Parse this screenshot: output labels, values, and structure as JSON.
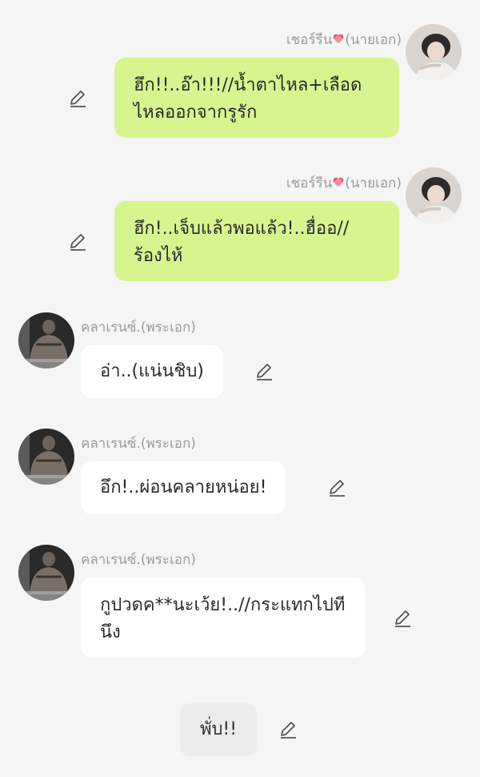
{
  "messages": [
    {
      "side": "right",
      "name": "เชอร์รีน",
      "name_suffix": "(นายเอก)",
      "text": "ฮึก!!..อ๊า!!!//น้ำตาไหล+เลือดไหลออกจากรูรัก"
    },
    {
      "side": "right",
      "name": "เชอร์รีน",
      "name_suffix": "(นายเอก)",
      "text": "ฮึก!..เจ็บแล้วพอแล้ว!..ฮื่ออ//ร้องไห้"
    },
    {
      "side": "left",
      "name": "คลาเรนซ์.(พระเอก)",
      "text": "อ่า..(แน่นชิบ)"
    },
    {
      "side": "left",
      "name": "คลาเรนซ์.(พระเอก)",
      "text": "อึก!..ผ่อนคลายหน่อย!"
    },
    {
      "side": "left",
      "name": "คลาเรนซ์.(พระเอก)",
      "text": "กูปวดค**นะเว้ย!..//กระแทกไปทีนึง"
    }
  ],
  "narration": {
    "text": "พั่บ!!"
  },
  "icons": {
    "edit": "pencil-edit-icon",
    "name_decoration": "heart-icon"
  },
  "colors": {
    "background": "#f5f5f5",
    "right_bubble": "#d6f58f",
    "left_bubble": "#ffffff",
    "name_text": "#9a9a9a",
    "heart": "#e8506a"
  }
}
